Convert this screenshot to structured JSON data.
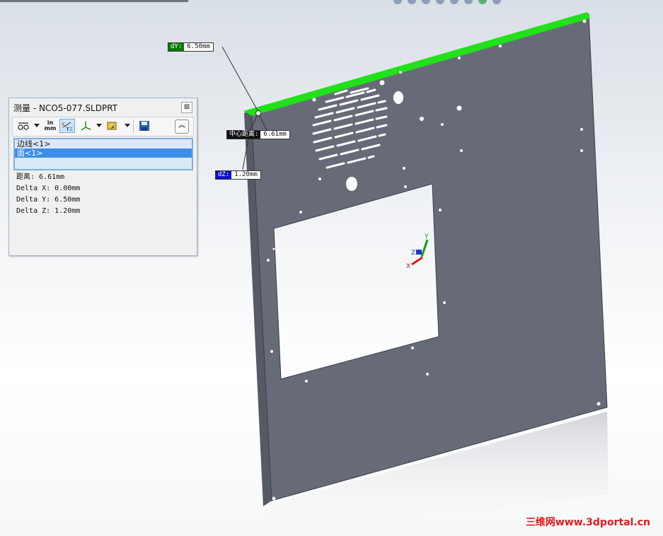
{
  "measure_dialog": {
    "title": "测量 - NCO5-077.SLDPRT",
    "close_glyph": "⊠",
    "collapse_glyph": "︽",
    "selections": [
      "边线<1>",
      "面<1>"
    ],
    "results": [
      "距离: 6.61mm",
      "Delta X: 0.00mm",
      "Delta Y: 6.50mm",
      "Delta Z: 1.20mm"
    ],
    "units_label_top": "in",
    "units_label_bottom": "mm"
  },
  "callouts": {
    "dy": {
      "label": "dY:",
      "value": "6.50mm",
      "color": "#0a7a0a"
    },
    "center": {
      "label": "中心距离:",
      "value": "6.61mm",
      "color": "#111111"
    },
    "dz": {
      "label": "dZ:",
      "value": "1.20mm",
      "color": "#1010c8"
    }
  },
  "triad": {
    "x": "X",
    "y": "Y",
    "z": "Z"
  },
  "watermark": "三维网www.3dportal.cn",
  "colors": {
    "panel_face": "#676b78",
    "highlight_edge": "#22e01a",
    "selection_blue": "#3d8ee6"
  }
}
